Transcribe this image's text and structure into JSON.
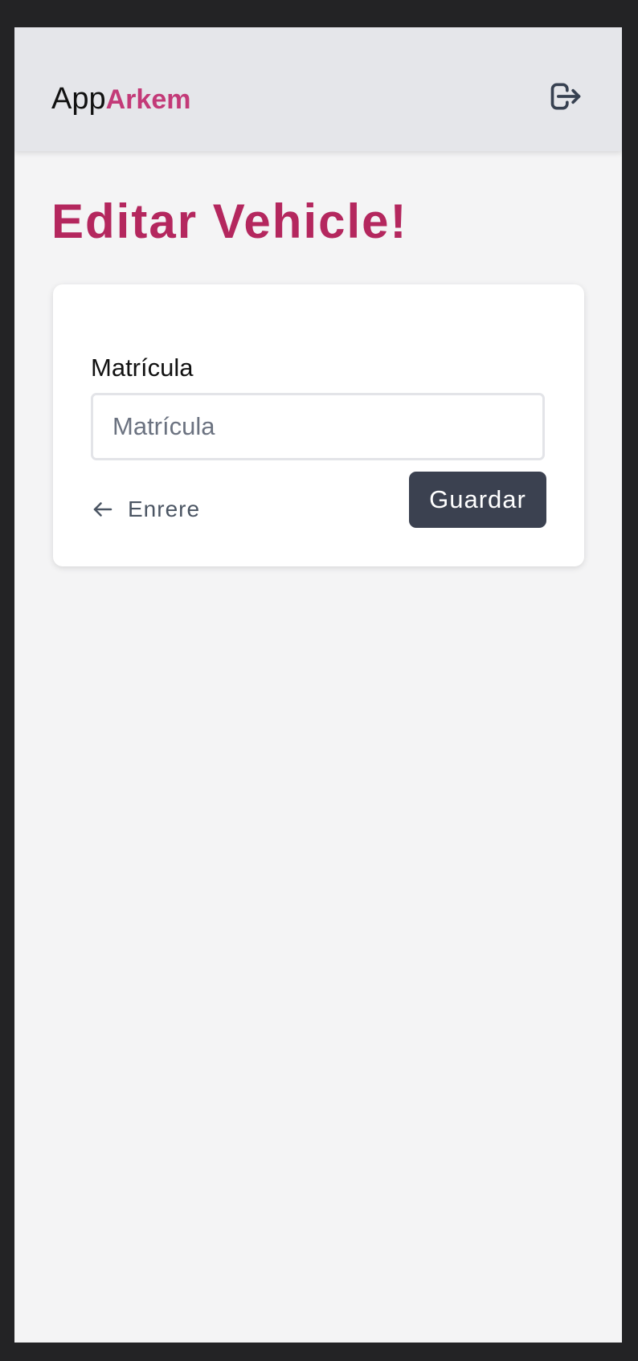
{
  "header": {
    "brand_prefix": "App",
    "brand_name": "Arkem",
    "logout_icon": "logout-icon"
  },
  "page": {
    "title": "Editar Vehicle!"
  },
  "form": {
    "plate_label": "Matrícula",
    "plate_placeholder": "Matrícula",
    "plate_value": "",
    "back_icon": "arrow-left-icon",
    "back_label": "Enrere",
    "save_label": "Guardar"
  },
  "colors": {
    "brand_accent": "#c33a78",
    "title": "#b4275e",
    "header_bg": "#e5e6ea",
    "page_bg": "#f4f4f5",
    "button_bg": "#3b4150"
  }
}
